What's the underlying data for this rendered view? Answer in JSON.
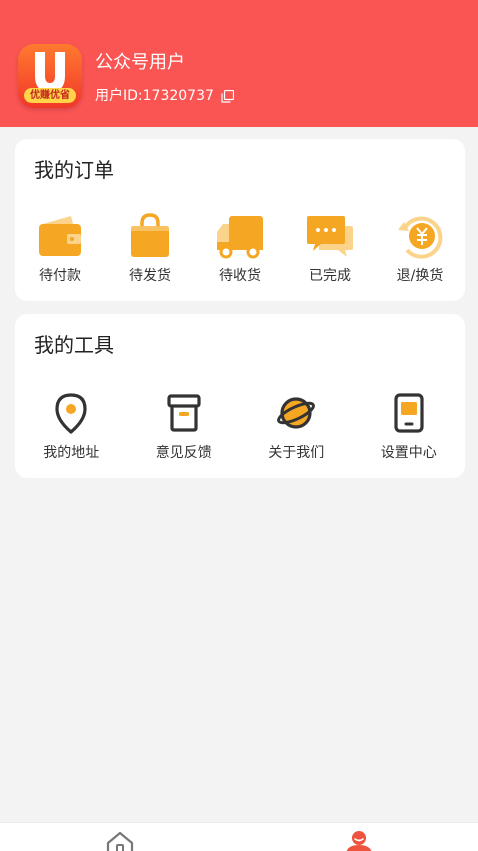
{
  "header": {
    "logo_text": "优赚优省",
    "username": "公众号用户",
    "userid_label": "用户ID:",
    "userid_value": "17320737",
    "bg_color": "#fa5453"
  },
  "orders": {
    "title": "我的订单",
    "items": [
      {
        "label": "待付款",
        "icon": "wallet-icon"
      },
      {
        "label": "待发货",
        "icon": "shopping-bag-icon"
      },
      {
        "label": "待收货",
        "icon": "truck-icon"
      },
      {
        "label": "已完成",
        "icon": "chat-bubble-icon"
      },
      {
        "label": "退/换货",
        "icon": "yen-refund-icon"
      }
    ]
  },
  "tools": {
    "title": "我的工具",
    "items": [
      {
        "label": "我的地址",
        "icon": "location-pin-icon"
      },
      {
        "label": "意见反馈",
        "icon": "feedback-box-icon"
      },
      {
        "label": "关于我们",
        "icon": "planet-icon"
      },
      {
        "label": "设置中心",
        "icon": "phone-settings-icon"
      }
    ]
  },
  "tabbar": {
    "tabs": [
      {
        "icon": "home-icon",
        "active": false
      },
      {
        "icon": "user-icon",
        "active": true
      }
    ]
  },
  "colors": {
    "accent": "#fa5453",
    "icon_orange": "#f5a623",
    "icon_light": "#fbd38a",
    "page_bg": "#f3f3f3"
  }
}
